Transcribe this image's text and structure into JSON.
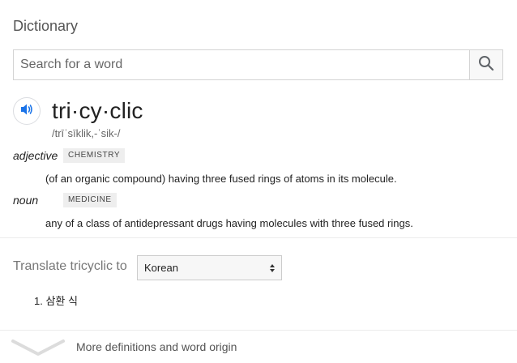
{
  "header": {
    "title": "Dictionary"
  },
  "search": {
    "placeholder": "Search for a word",
    "value": ""
  },
  "entry": {
    "word": "tri·cy·clic",
    "phonetic": "/trīˈsīklik,-ˈsik-/",
    "senses": [
      {
        "part_of_speech": "adjective",
        "domain": "CHEMISTRY",
        "definition": "(of an organic compound) having three fused rings of atoms in its molecule."
      },
      {
        "part_of_speech": "noun",
        "domain": "MEDICINE",
        "definition": "any of a class of antidepressant drugs having molecules with three fused rings."
      }
    ]
  },
  "translate": {
    "label": "Translate tricyclic to",
    "selected_language": "Korean",
    "results": [
      "1. 삼환 식"
    ]
  },
  "footer": {
    "more_label": "More definitions and word origin"
  },
  "icons": {
    "search": "magnifier-icon",
    "audio": "speaker-icon",
    "more": "chevron-down-icon"
  },
  "colors": {
    "accent_blue": "#1a73e8",
    "tag_bg": "#eeeeee",
    "muted_text": "#777777"
  }
}
